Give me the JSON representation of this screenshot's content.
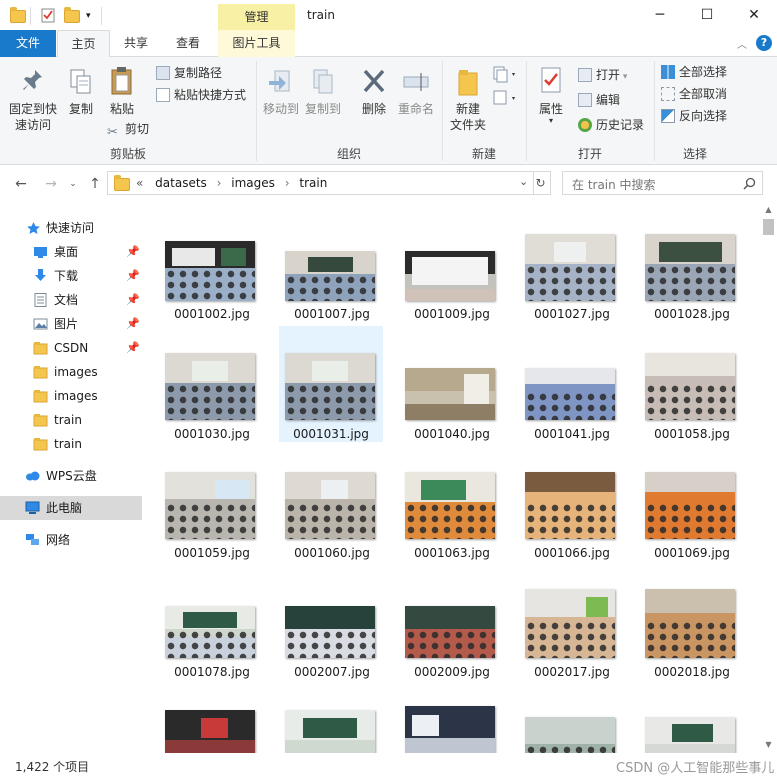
{
  "window": {
    "context_tab": "管理",
    "title": "train",
    "minimize": "─",
    "maximize": "☐",
    "close": "✕"
  },
  "tabs": [
    {
      "label": "文件"
    },
    {
      "label": "主页"
    },
    {
      "label": "共享"
    },
    {
      "label": "查看"
    },
    {
      "label": "图片工具"
    }
  ],
  "ribbon": {
    "clipboard": {
      "pin_quick_access": "固定到快\n速访问",
      "copy": "复制",
      "paste": "粘贴",
      "copy_path": "复制路径",
      "paste_shortcut": "粘贴快捷方式",
      "cut": "剪切",
      "group_label": "剪贴板"
    },
    "organize": {
      "move_to": "移动到",
      "copy_to": "复制到",
      "delete": "删除",
      "rename": "重命名",
      "group_label": "组织"
    },
    "new": {
      "new_folder": "新建\n文件夹",
      "group_label": "新建"
    },
    "open": {
      "properties": "属性",
      "open": "打开",
      "edit": "编辑",
      "history": "历史记录",
      "group_label": "打开"
    },
    "select": {
      "select_all": "全部选择",
      "select_none": "全部取消",
      "invert": "反向选择",
      "group_label": "选择"
    }
  },
  "address": {
    "overflow": "«",
    "crumbs": [
      "datasets",
      "images",
      "train"
    ],
    "search_placeholder": "在 train 中搜索"
  },
  "sidebar": {
    "items": [
      {
        "label": "快速访问",
        "icon": "star-icon",
        "pinned": false
      },
      {
        "label": "桌面",
        "icon": "desktop-icon",
        "pinned": true
      },
      {
        "label": "下载",
        "icon": "download-icon",
        "pinned": true
      },
      {
        "label": "文档",
        "icon": "document-icon",
        "pinned": true
      },
      {
        "label": "图片",
        "icon": "pictures-icon",
        "pinned": true
      },
      {
        "label": "CSDN",
        "icon": "folder-icon",
        "pinned": true
      },
      {
        "label": "images",
        "icon": "folder-icon",
        "pinned": false
      },
      {
        "label": "images",
        "icon": "folder-icon",
        "pinned": false
      },
      {
        "label": "train",
        "icon": "folder-icon",
        "pinned": false
      },
      {
        "label": "train",
        "icon": "folder-icon",
        "pinned": false
      },
      {
        "label": "WPS云盘",
        "icon": "cloud-icon",
        "pinned": false
      },
      {
        "label": "此电脑",
        "icon": "computer-icon",
        "pinned": false,
        "selected": true
      },
      {
        "label": "网络",
        "icon": "network-icon",
        "pinned": false
      }
    ]
  },
  "files": [
    {
      "name": "0001002.jpg"
    },
    {
      "name": "0001007.jpg"
    },
    {
      "name": "0001009.jpg"
    },
    {
      "name": "0001027.jpg"
    },
    {
      "name": "0001028.jpg"
    },
    {
      "name": "0001030.jpg"
    },
    {
      "name": "0001031.jpg",
      "selected": true
    },
    {
      "name": "0001040.jpg"
    },
    {
      "name": "0001041.jpg"
    },
    {
      "name": "0001058.jpg"
    },
    {
      "name": "0001059.jpg"
    },
    {
      "name": "0001060.jpg"
    },
    {
      "name": "0001063.jpg"
    },
    {
      "name": "0001066.jpg"
    },
    {
      "name": "0001069.jpg"
    },
    {
      "name": "0001078.jpg"
    },
    {
      "name": "0002007.jpg"
    },
    {
      "name": "0002009.jpg"
    },
    {
      "name": "0002017.jpg"
    },
    {
      "name": "0002018.jpg"
    }
  ],
  "status": {
    "item_count": "1,422 个项目",
    "watermark": "CSDN @人工智能那些事儿"
  },
  "colors": {
    "accent": "#1979ca",
    "selection": "#cce8ff",
    "context_tab": "#f8f0a4"
  }
}
